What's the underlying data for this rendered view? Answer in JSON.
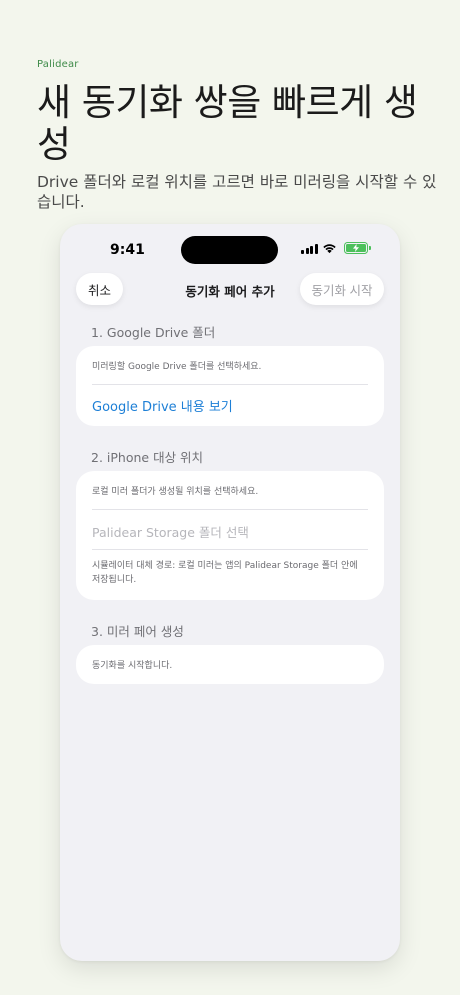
{
  "brand": "Palidear",
  "headline": "새 동기화 쌍을 빠르게 생성",
  "subline": "Drive 폴더와 로컬 위치를 고르면 바로 미러링을 시작할 수 있습니다.",
  "status_bar": {
    "time": "9:41",
    "battery_color": "#4cc05b"
  },
  "nav": {
    "cancel_label": "취소",
    "title": "동기화 페어 추가",
    "start_label": "동기화 시작"
  },
  "sections": {
    "drive": {
      "header": "1. Google Drive 폴더",
      "hint": "미러링할 Google Drive 폴더를 선택하세요.",
      "action": "Google Drive 내용 보기"
    },
    "iphone": {
      "header": "2. iPhone 대상 위치",
      "hint": "로컬 미러 폴더가 생성될 위치를 선택하세요.",
      "placeholder": "Palidear Storage 폴더 선택",
      "note": "시뮬레이터 대체 경로: 로컬 미러는 앱의 Palidear Storage 폴더 안에 저장됩니다."
    },
    "create": {
      "header": "3. 미러 페어 생성",
      "hint": "동기화를 시작합니다."
    }
  },
  "colors": {
    "accent": "#1d7fd6",
    "brand": "#3f8b4a",
    "background": "#f3f6ed"
  }
}
